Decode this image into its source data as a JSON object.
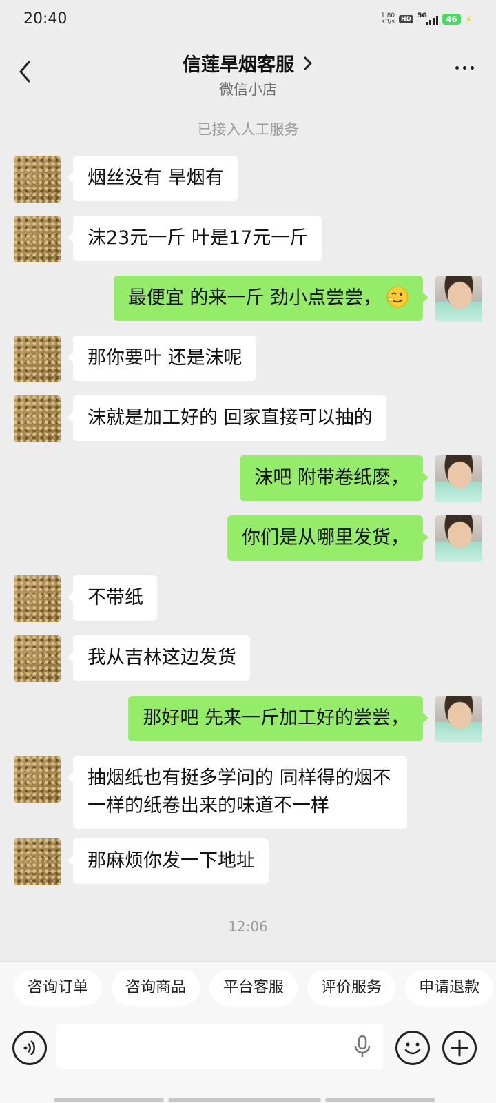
{
  "status_bar": {
    "time": "20:40",
    "net_speed_value": "1.80",
    "net_speed_unit": "KB/s",
    "hd_badge": "HD",
    "signal_label": "5G",
    "battery": "46"
  },
  "header": {
    "title": "信莲旱烟客服",
    "subtitle": "微信小店"
  },
  "system_notice": "已接入人工服务",
  "messages": [
    {
      "side": "left",
      "text": "烟丝没有   旱烟有"
    },
    {
      "side": "left",
      "text": "沫23元一斤  叶是17元一斤"
    },
    {
      "side": "right",
      "text": "最便宜 的来一斤 劲小点尝尝，",
      "emoji": "smirk-emoji"
    },
    {
      "side": "left",
      "text": "那你要叶   还是沫呢"
    },
    {
      "side": "left",
      "text": "沫就是加工好的  回家直接可以抽的"
    },
    {
      "side": "right",
      "text": "沫吧 附带卷纸麽，"
    },
    {
      "side": "right",
      "text": "你们是从哪里发货，"
    },
    {
      "side": "left",
      "text": "不带纸"
    },
    {
      "side": "left",
      "text": "我从吉林这边发货"
    },
    {
      "side": "right",
      "text": "那好吧 先来一斤加工好的尝尝，"
    },
    {
      "side": "left",
      "text": "抽烟纸也有挺多学问的  同样得的烟不一样的纸卷出来的味道不一样"
    },
    {
      "side": "left",
      "text": "那麻烦你发一下地址"
    }
  ],
  "time_divider": "12:06",
  "quick_replies": [
    "咨询订单",
    "咨询商品",
    "平台客服",
    "评价服务",
    "申请退款"
  ],
  "input": {
    "placeholder": ""
  },
  "colors": {
    "background": "#ededed",
    "sent_bubble": "#95ec69",
    "received_bubble": "#ffffff"
  }
}
